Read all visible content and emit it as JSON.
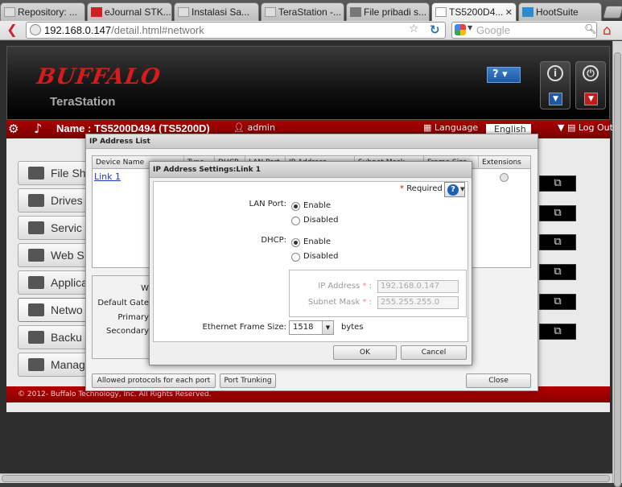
{
  "browser": {
    "tabs": [
      {
        "label": "Repository: ..."
      },
      {
        "label": "eJournal STK..."
      },
      {
        "label": "Instalasi Sa..."
      },
      {
        "label": "TeraStation -..."
      },
      {
        "label": "File pribadi s..."
      },
      {
        "label": "TS5200D4...",
        "active": true
      },
      {
        "label": "HootSuite"
      }
    ],
    "url_host": "192.168.0.147",
    "url_path": "/detail.html#network",
    "search_placeholder": "Google"
  },
  "header": {
    "logo": "BUFFALO",
    "product": "TeraStation",
    "help_label": "?",
    "name_label": "Name : TS5200D494 (TS5200D)",
    "user": "admin",
    "language_label": "Language",
    "language_value": "English",
    "logout_label": "Log Out"
  },
  "sidebar": {
    "items": [
      {
        "label": "File Sh",
        "icon": "folder-icon"
      },
      {
        "label": "Drives",
        "icon": "drive-icon"
      },
      {
        "label": "Servic",
        "icon": "services-icon"
      },
      {
        "label": "Web S",
        "icon": "web-icon"
      },
      {
        "label": "Applica",
        "icon": "applications-icon"
      },
      {
        "label": "Netwo",
        "icon": "network-icon",
        "selected": true
      },
      {
        "label": "Backu",
        "icon": "backup-icon"
      },
      {
        "label": "Manag",
        "icon": "management-icon"
      }
    ]
  },
  "footer": {
    "text": "© 2012- Buffalo Technology, Inc. All Rights Reserved."
  },
  "ip_list_dialog": {
    "title": "IP Address List",
    "columns": [
      "Device Name",
      "Type",
      "DHCP",
      "LAN Port",
      "IP Address",
      "Subnet Mask",
      "Frame Size",
      "Extensions"
    ],
    "rows": [
      {
        "device": "Link 1"
      }
    ],
    "detail_labels": [
      "W",
      "Default Gate",
      "Primary",
      "Secondary"
    ],
    "buttons": {
      "allowed": "Allowed protocols for each port",
      "trunking": "Port Trunking",
      "close": "Close"
    }
  },
  "ip_settings_dialog": {
    "title": "IP Address Settings:Link 1",
    "required_label": "Required",
    "lan_port_label": "LAN Port:",
    "lan_enable": "Enable",
    "lan_disabled": "Disabled",
    "dhcp_label": "DHCP:",
    "dhcp_enable": "Enable",
    "dhcp_disabled": "Disabled",
    "ip_address_label": "IP Address",
    "ip_address_value": "192.168.0.147",
    "subnet_label": "Subnet Mask",
    "subnet_value": "255.255.255.0",
    "frame_label": "Ethernet Frame Size:",
    "frame_value": "1518",
    "frame_unit": "bytes",
    "ok_label": "OK",
    "cancel_label": "Cancel"
  },
  "colors": {
    "brand_red": "#d51b1b",
    "bar_red": "#a00000",
    "help_blue": "#1e5fb4"
  }
}
